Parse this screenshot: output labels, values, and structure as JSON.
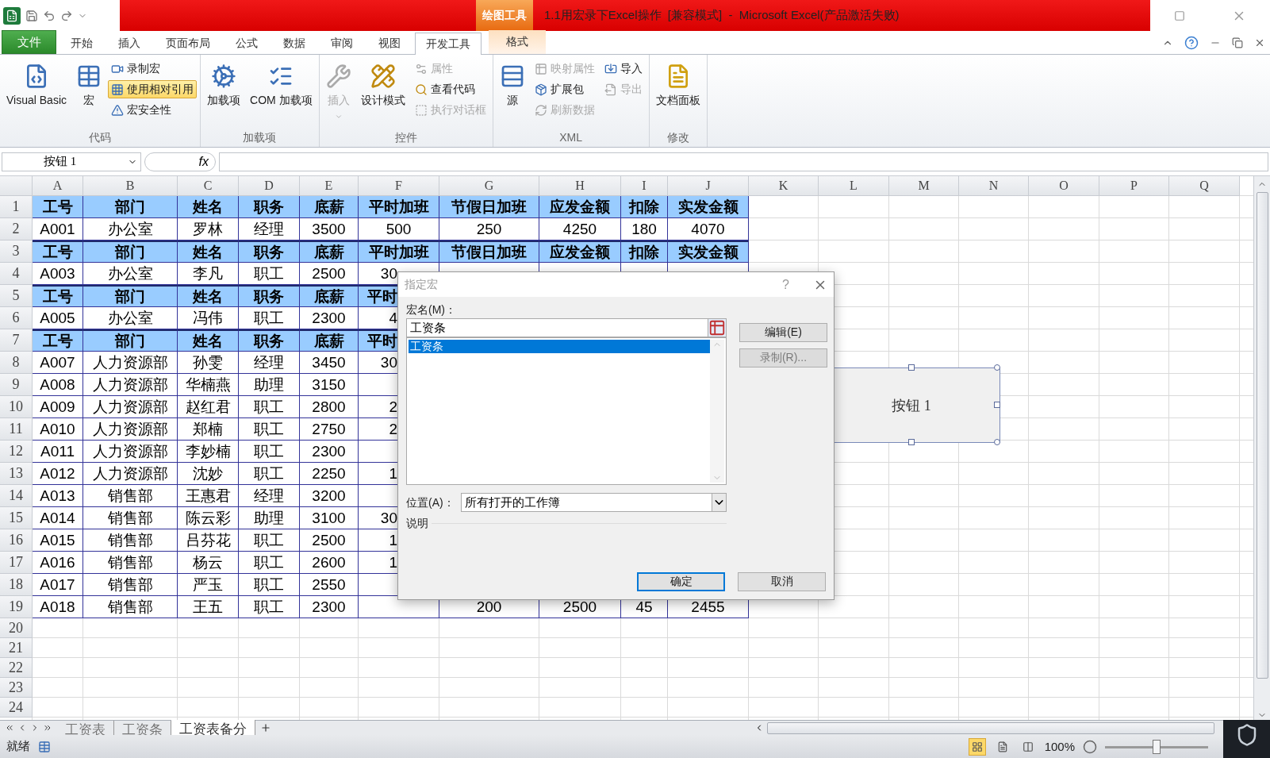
{
  "title_bar": {
    "contextual_label": "绘图工具",
    "title": "1.1用宏录下Excel操作  [兼容模式]  -  Microsoft Excel(产品激活失败)"
  },
  "ribbon_tabs": [
    {
      "label": "文件",
      "kind": "file",
      "selected": false
    },
    {
      "label": "开始",
      "kind": "normal",
      "selected": false
    },
    {
      "label": "插入",
      "kind": "normal",
      "selected": false
    },
    {
      "label": "页面布局",
      "kind": "normal",
      "selected": false
    },
    {
      "label": "公式",
      "kind": "normal",
      "selected": false
    },
    {
      "label": "数据",
      "kind": "normal",
      "selected": false
    },
    {
      "label": "审阅",
      "kind": "normal",
      "selected": false
    },
    {
      "label": "视图",
      "kind": "normal",
      "selected": false
    },
    {
      "label": "开发工具",
      "kind": "normal",
      "selected": true
    },
    {
      "label": "格式",
      "kind": "contextual",
      "selected": false
    }
  ],
  "ribbon_groups": [
    {
      "label": "代码",
      "items": [
        {
          "label": "Visual Basic",
          "kind": "large",
          "disabled": false,
          "on": false
        },
        {
          "label": "宏",
          "kind": "large",
          "disabled": false,
          "on": false
        },
        {
          "label": "录制宏",
          "kind": "small",
          "disabled": false,
          "on": false
        },
        {
          "label": "使用相对引用",
          "kind": "small",
          "disabled": false,
          "on": true
        },
        {
          "label": "宏安全性",
          "kind": "small",
          "disabled": false,
          "on": false
        }
      ]
    },
    {
      "label": "加载项",
      "items": [
        {
          "label": "加载项",
          "kind": "large",
          "disabled": false,
          "on": false
        },
        {
          "label": "COM 加载项",
          "kind": "large",
          "disabled": false,
          "on": false
        }
      ]
    },
    {
      "label": "控件",
      "items": [
        {
          "label": "插入",
          "kind": "large",
          "disabled": true,
          "on": false,
          "dropdown": true
        },
        {
          "label": "设计模式",
          "kind": "large",
          "disabled": false,
          "on": false
        },
        {
          "label": "属性",
          "kind": "small",
          "disabled": true,
          "on": false
        },
        {
          "label": "查看代码",
          "kind": "small",
          "disabled": false,
          "on": false
        },
        {
          "label": "执行对话框",
          "kind": "small",
          "disabled": true,
          "on": false
        }
      ]
    },
    {
      "label": "XML",
      "items": [
        {
          "label": "源",
          "kind": "large",
          "disabled": false,
          "on": false
        },
        {
          "label": "映射属性",
          "kind": "small",
          "disabled": true,
          "on": false
        },
        {
          "label": "扩展包",
          "kind": "small",
          "disabled": false,
          "on": false
        },
        {
          "label": "刷新数据",
          "kind": "small",
          "disabled": true,
          "on": false
        },
        {
          "label": "导入",
          "kind": "small",
          "disabled": false,
          "on": false
        },
        {
          "label": "导出",
          "kind": "small",
          "disabled": true,
          "on": false
        }
      ]
    },
    {
      "label": "修改",
      "items": [
        {
          "label": "文档面板",
          "kind": "large",
          "disabled": false,
          "on": false
        }
      ]
    }
  ],
  "formula_bar": {
    "name_box": "按钮 1",
    "fx_label": "fx"
  },
  "sheet": {
    "columns": [
      "A",
      "B",
      "C",
      "D",
      "E",
      "F",
      "G",
      "H",
      "I",
      "J",
      "K",
      "L",
      "M",
      "N",
      "O",
      "P",
      "Q"
    ],
    "rows": [
      {
        "number": "1",
        "kind": "header",
        "cells": [
          "工号",
          "部门",
          "姓名",
          "职务",
          "底薪",
          "平时加班",
          "节假日加班",
          "应发金额",
          "扣除",
          "实发金额"
        ]
      },
      {
        "number": "2",
        "kind": "data",
        "cells": [
          "A001",
          "办公室",
          "罗林",
          "经理",
          "3500",
          "500",
          "250",
          "4250",
          "180",
          "4070"
        ]
      },
      {
        "number": "3",
        "kind": "header",
        "cells": [
          "工号",
          "部门",
          "姓名",
          "职务",
          "底薪",
          "平时加班",
          "节假日加班",
          "应发金额",
          "扣除",
          "实发金额"
        ]
      },
      {
        "number": "4",
        "kind": "data",
        "cells": [
          "A003",
          "办公室",
          "李凡",
          "职工",
          "2500",
          "30",
          null,
          null,
          null,
          null
        ]
      },
      {
        "number": "5",
        "kind": "header",
        "cells": [
          "工号",
          "部门",
          "姓名",
          "职务",
          "底薪",
          "平时",
          null,
          null,
          null,
          null
        ]
      },
      {
        "number": "6",
        "kind": "data",
        "cells": [
          "A005",
          "办公室",
          "冯伟",
          "职工",
          "2300",
          "4",
          null,
          null,
          null,
          null
        ]
      },
      {
        "number": "7",
        "kind": "header",
        "cells": [
          "工号",
          "部门",
          "姓名",
          "职务",
          "底薪",
          "平时",
          null,
          null,
          null,
          null
        ]
      },
      {
        "number": "8",
        "kind": "data",
        "cells": [
          "A007",
          "人力资源部",
          "孙雯",
          "经理",
          "3450",
          "30",
          null,
          null,
          null,
          null
        ]
      },
      {
        "number": "9",
        "kind": "data",
        "cells": [
          "A008",
          "人力资源部",
          "华楠燕",
          "助理",
          "3150",
          null,
          null,
          null,
          null,
          null
        ]
      },
      {
        "number": "10",
        "kind": "data",
        "cells": [
          "A009",
          "人力资源部",
          "赵红君",
          "职工",
          "2800",
          "2",
          null,
          null,
          null,
          null
        ]
      },
      {
        "number": "11",
        "kind": "data",
        "cells": [
          "A010",
          "人力资源部",
          "郑楠",
          "职工",
          "2750",
          "2",
          null,
          null,
          null,
          null
        ]
      },
      {
        "number": "12",
        "kind": "data",
        "cells": [
          "A011",
          "人力资源部",
          "李妙楠",
          "职工",
          "2300",
          null,
          null,
          null,
          null,
          null
        ]
      },
      {
        "number": "13",
        "kind": "data",
        "cells": [
          "A012",
          "人力资源部",
          "沈妙",
          "职工",
          "2250",
          "1",
          null,
          null,
          null,
          null
        ]
      },
      {
        "number": "14",
        "kind": "data",
        "cells": [
          "A013",
          "销售部",
          "王惠君",
          "经理",
          "3200",
          null,
          null,
          null,
          null,
          null
        ]
      },
      {
        "number": "15",
        "kind": "data",
        "cells": [
          "A014",
          "销售部",
          "陈云彩",
          "助理",
          "3100",
          "30",
          null,
          null,
          null,
          null
        ]
      },
      {
        "number": "16",
        "kind": "data",
        "cells": [
          "A015",
          "销售部",
          "吕芬花",
          "职工",
          "2500",
          "1",
          null,
          null,
          null,
          null
        ]
      },
      {
        "number": "17",
        "kind": "data",
        "cells": [
          "A016",
          "销售部",
          "杨云",
          "职工",
          "2600",
          "1",
          null,
          null,
          null,
          null
        ]
      },
      {
        "number": "18",
        "kind": "data",
        "cells": [
          "A017",
          "销售部",
          "严玉",
          "职工",
          "2550",
          null,
          null,
          null,
          null,
          null
        ]
      },
      {
        "number": "19",
        "kind": "data",
        "cells": [
          "A018",
          "销售部",
          "王五",
          "职工",
          "2300",
          null,
          "200",
          "2500",
          "45",
          "2455"
        ]
      },
      {
        "number": "20",
        "kind": "empty"
      },
      {
        "number": "21",
        "kind": "empty"
      },
      {
        "number": "22",
        "kind": "empty"
      },
      {
        "number": "23",
        "kind": "empty"
      },
      {
        "number": "24",
        "kind": "empty"
      }
    ]
  },
  "shape": {
    "label": "按钮 1",
    "selected": true
  },
  "dialog": {
    "title": "指定宏",
    "help": "?",
    "name_label": "宏名(M)：",
    "name_value": "工资条",
    "macros": [
      {
        "label": "工资条",
        "selected": true
      }
    ],
    "side_buttons": [
      {
        "label": "编辑(E)",
        "disabled": false
      },
      {
        "label": "录制(R)...",
        "disabled": true
      }
    ],
    "location_label": "位置(A)：",
    "location_value": "所有打开的工作簿",
    "description_label": "说明",
    "footer_buttons": [
      {
        "label": "确定",
        "default": true
      },
      {
        "label": "取消",
        "default": false
      }
    ]
  },
  "sheet_tabs": [
    {
      "label": "工资表",
      "selected": false
    },
    {
      "label": "工资条",
      "selected": false
    },
    {
      "label": "工资表备分",
      "selected": true
    }
  ],
  "status_bar": {
    "status": "就绪",
    "views": [
      {
        "selected": true
      },
      {
        "selected": false
      },
      {
        "selected": false
      }
    ],
    "zoom": "100%",
    "zoom_slider": {
      "level": 0.5
    }
  }
}
